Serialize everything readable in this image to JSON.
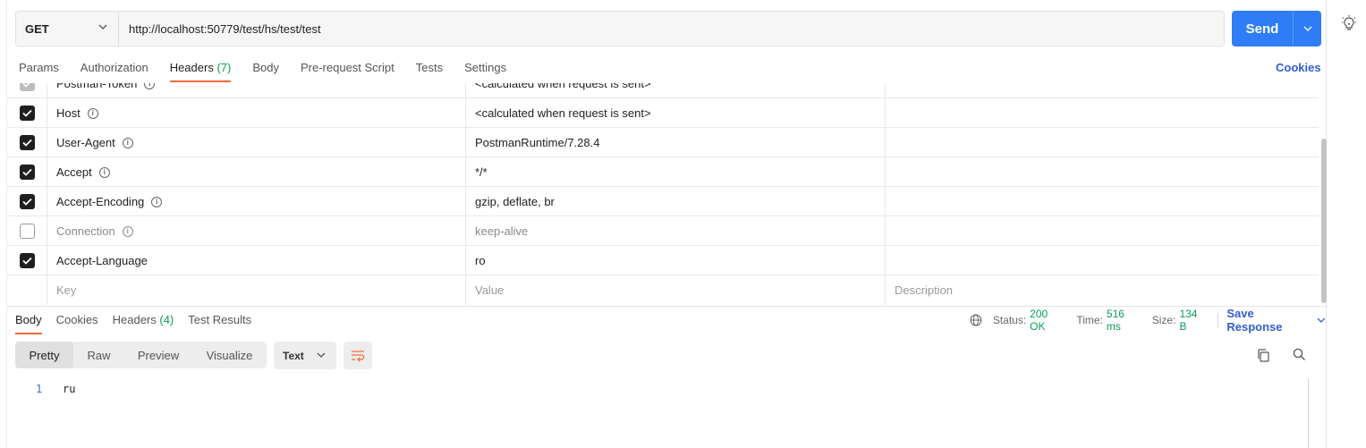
{
  "request": {
    "method": "GET",
    "url": "http://localhost:50779/test/hs/test/test",
    "send_label": "Send"
  },
  "request_tabs": [
    {
      "label": "Params",
      "count": ""
    },
    {
      "label": "Authorization",
      "count": ""
    },
    {
      "label": "Headers",
      "count": "(7)"
    },
    {
      "label": "Body",
      "count": ""
    },
    {
      "label": "Pre-request Script",
      "count": ""
    },
    {
      "label": "Tests",
      "count": ""
    },
    {
      "label": "Settings",
      "count": ""
    }
  ],
  "active_request_tab": "Headers",
  "cookies_label": "Cookies",
  "headers": [
    {
      "key": "Postman-Token",
      "value": "<calculated when request is sent>",
      "checked": true,
      "faded": true
    },
    {
      "key": "Host",
      "value": "<calculated when request is sent>",
      "checked": true
    },
    {
      "key": "User-Agent",
      "value": "PostmanRuntime/7.28.4",
      "checked": true
    },
    {
      "key": "Accept",
      "value": "*/*",
      "checked": true
    },
    {
      "key": "Accept-Encoding",
      "value": "gzip, deflate, br",
      "checked": true
    },
    {
      "key": "Connection",
      "value": "keep-alive",
      "checked": false
    },
    {
      "key": "Accept-Language",
      "value": "ro",
      "checked": true
    }
  ],
  "new_row_placeholders": {
    "key": "Key",
    "value": "Value",
    "description": "Description"
  },
  "response_tabs": [
    {
      "label": "Body",
      "count": ""
    },
    {
      "label": "Cookies",
      "count": ""
    },
    {
      "label": "Headers",
      "count": "(4)"
    },
    {
      "label": "Test Results",
      "count": ""
    }
  ],
  "response_status": {
    "status_label": "Status:",
    "status_value": "200 OK",
    "time_label": "Time:",
    "time_value": "516 ms",
    "size_label": "Size:",
    "size_value": "134 B",
    "save_label": "Save Response"
  },
  "view_modes": [
    "Pretty",
    "Raw",
    "Preview",
    "Visualize"
  ],
  "active_view_mode": "Pretty",
  "format": "Text",
  "code_lines": [
    {
      "number": "1",
      "text": "ru"
    }
  ],
  "colors": {
    "accent": "#f26b3a",
    "send": "#2f7df6",
    "link": "#2f5fd0",
    "success": "#0a9c55"
  },
  "icons": [
    "chevron-down-icon",
    "info-icon",
    "checkmark-icon",
    "globe-icon",
    "wrap-lines-icon",
    "copy-icon",
    "search-icon",
    "lightbulb-icon"
  ]
}
